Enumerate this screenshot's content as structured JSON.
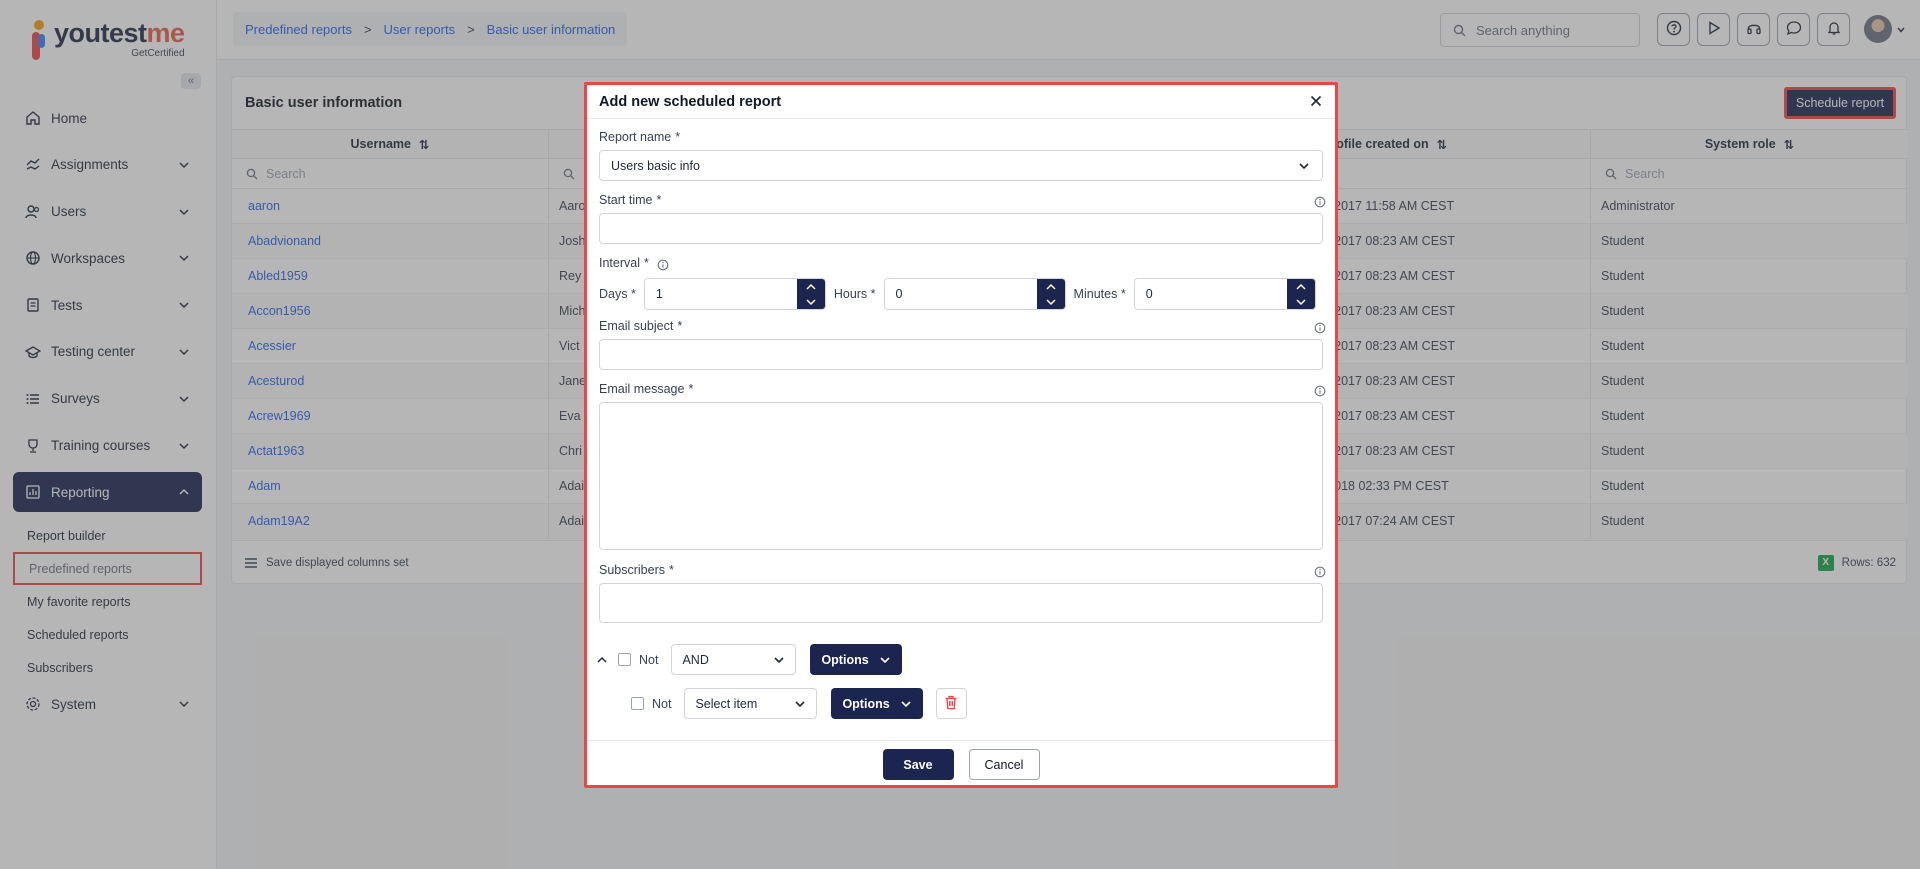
{
  "brand": {
    "name_part1": "youtest",
    "name_part2": "me",
    "tagline": "GetCertified"
  },
  "sidebar": {
    "collapse_label": "«",
    "items": [
      {
        "label": "Home",
        "icon": "home-icon"
      },
      {
        "label": "Assignments",
        "icon": "assignments-icon"
      },
      {
        "label": "Users",
        "icon": "users-icon"
      },
      {
        "label": "Workspaces",
        "icon": "globe-icon"
      },
      {
        "label": "Tests",
        "icon": "tests-icon"
      },
      {
        "label": "Testing center",
        "icon": "testing-center-icon"
      },
      {
        "label": "Surveys",
        "icon": "list-icon"
      },
      {
        "label": "Training courses",
        "icon": "trophy-icon"
      },
      {
        "label": "Reporting",
        "icon": "reporting-icon"
      }
    ],
    "reporting_sub": [
      "Report builder",
      "Predefined reports",
      "My favorite reports",
      "Scheduled reports",
      "Subscribers"
    ],
    "system_label": "System"
  },
  "topbar": {
    "breadcrumb": [
      "Predefined reports",
      "User reports",
      "Basic user information"
    ],
    "breadcrumb_sep": ">",
    "search_placeholder": "Search anything"
  },
  "card": {
    "title": "Basic user information",
    "schedule_button": "Schedule report",
    "columns": [
      "Username",
      "",
      "Profile created on",
      "System role"
    ],
    "search_placeholder": "Search",
    "rows": [
      {
        "username": "aaron",
        "name": "Aaro",
        "created": "8-2017 11:58 AM CEST",
        "role": "Administrator"
      },
      {
        "username": "Abadvionand",
        "name": "Josh",
        "created": "9-2017 08:23 AM CEST",
        "role": "Student"
      },
      {
        "username": "Abled1959",
        "name": "Rey",
        "created": "9-2017 08:23 AM CEST",
        "role": "Student"
      },
      {
        "username": "Accon1956",
        "name": "Mich",
        "created": "9-2017 08:23 AM CEST",
        "role": "Student"
      },
      {
        "username": "Acessier",
        "name": "Vict",
        "created": "9-2017 08:23 AM CEST",
        "role": "Student"
      },
      {
        "username": "Acesturod",
        "name": "Jane",
        "created": "9-2017 08:23 AM CEST",
        "role": "Student"
      },
      {
        "username": "Acrew1969",
        "name": "Eva",
        "created": "9-2017 08:23 AM CEST",
        "role": "Student"
      },
      {
        "username": "Actat1963",
        "name": "Chri",
        "created": "9-2017 08:23 AM CEST",
        "role": "Student"
      },
      {
        "username": "Adam",
        "name": "Adai",
        "created": "-2018 02:33 PM CEST",
        "role": "Student"
      },
      {
        "username": "Adam19A2",
        "name": "Adai",
        "created": "0-2017 07:24 AM CEST",
        "role": "Student"
      }
    ],
    "footer_left": "Save displayed columns set",
    "rows_count": "Rows: 632",
    "excel_label": "X"
  },
  "modal": {
    "title": "Add new scheduled report",
    "report_name_label": "Report name",
    "report_name_value": "Users basic info",
    "start_time_label": "Start time",
    "interval_label": "Interval",
    "days_label": "Days",
    "days_value": "1",
    "hours_label": "Hours",
    "hours_value": "0",
    "minutes_label": "Minutes",
    "minutes_value": "0",
    "email_subject_label": "Email subject",
    "email_message_label": "Email message",
    "subscribers_label": "Subscribers",
    "required_mark": "*",
    "not_label": "Not",
    "and_value": "AND",
    "options_label": "Options",
    "select_item_placeholder": "Select item",
    "save_label": "Save",
    "cancel_label": "Cancel"
  },
  "colors": {
    "primary": "#1b2550",
    "highlight": "#ef4444",
    "link": "#2563eb"
  }
}
